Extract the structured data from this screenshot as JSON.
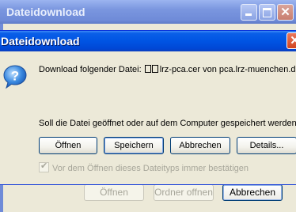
{
  "background_window": {
    "title": "Dateidownload",
    "buttons": {
      "open": "Öffnen",
      "open_folder": "Ordner offnen",
      "cancel": "Abbrechen"
    }
  },
  "dialog": {
    "title": "Dateidownload",
    "close_glyph": "✕",
    "download_prefix": "Download folgender Datei: ",
    "download_suffix": "lrz-pca.cer von pca.lrz-muenchen.de",
    "question": "Soll die Datei geöffnet oder auf dem Computer gespeichert werden?",
    "buttons": {
      "open": "Öffnen",
      "save": "Speichern",
      "cancel": "Abbrechen",
      "details": "Details..."
    },
    "checkbox_label": "Vor dem Öffnen dieses Dateityps immer bestätigen",
    "checkbox_checked": true
  },
  "icons": {
    "dialog_icon": "question-icon",
    "minimize": "minimize-icon",
    "maximize": "maximize-icon",
    "close": "close-icon"
  }
}
